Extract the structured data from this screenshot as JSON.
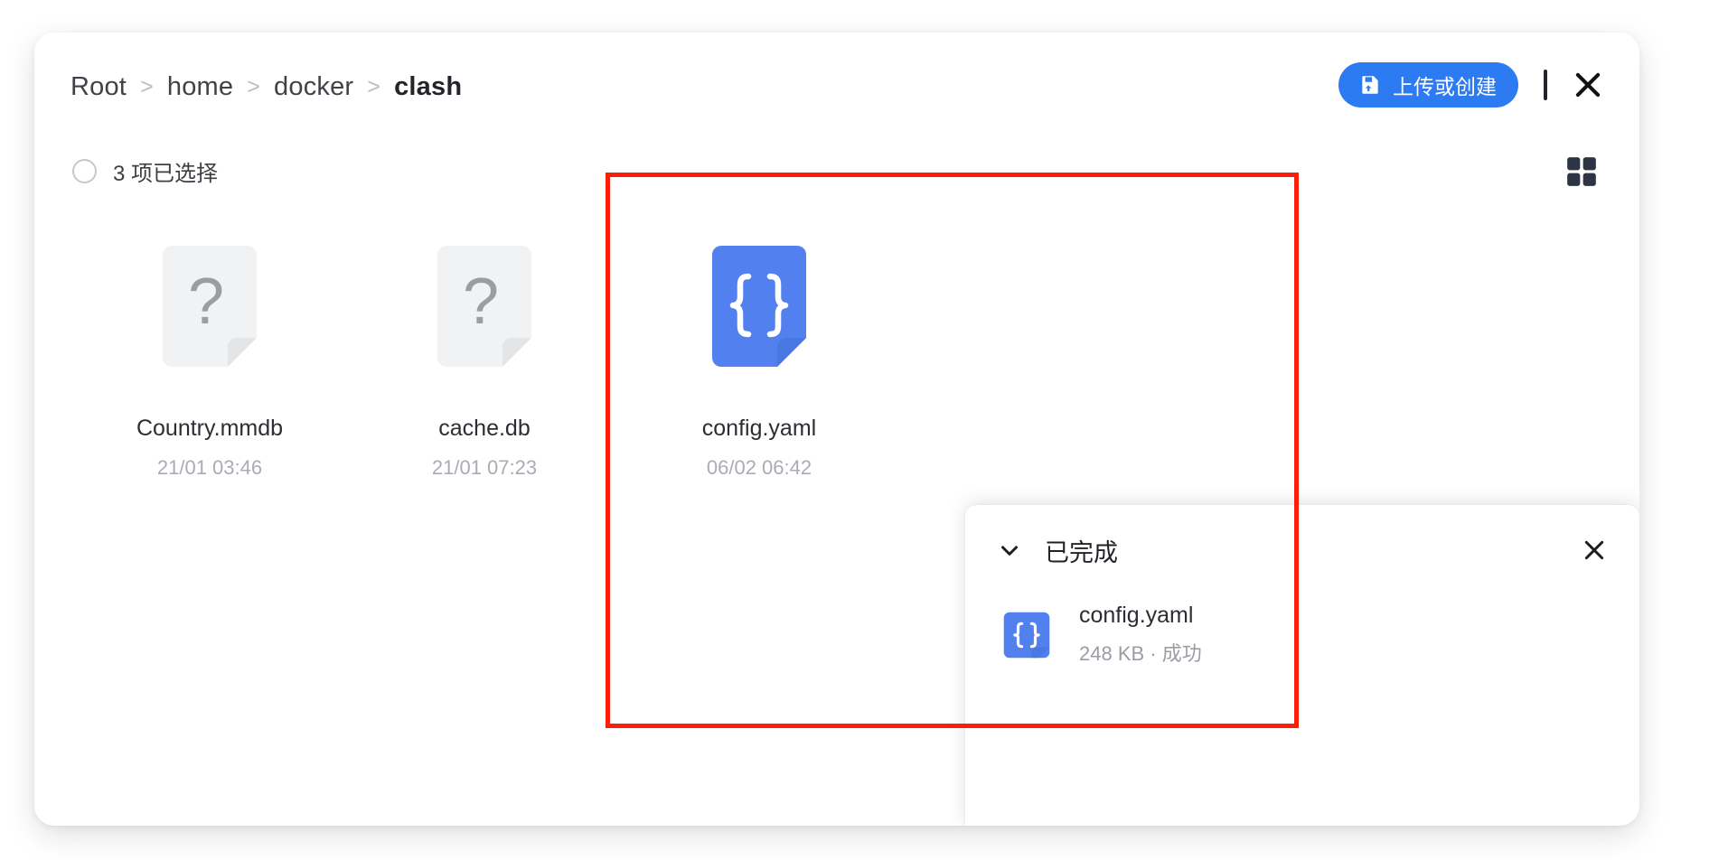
{
  "header": {
    "breadcrumb": [
      {
        "label": "Root",
        "current": false
      },
      {
        "label": "home",
        "current": false
      },
      {
        "label": "docker",
        "current": false
      },
      {
        "label": "clash",
        "current": true
      }
    ],
    "separator": ">",
    "upload_button_label": "上传或创建",
    "upload_button_icon": "save-upload-icon",
    "close_icon": "close-icon",
    "accent_color": "#2c7bf2"
  },
  "toolbar": {
    "selection_label": "3 项已选择",
    "selection_icon": "circle-unchecked-icon",
    "view_toggle_icon": "grid-view-icon"
  },
  "files": [
    {
      "name": "Country.mmdb",
      "date": "21/01 03:46",
      "icon": "unknown-file-icon",
      "icon_color": "#f1f2f3"
    },
    {
      "name": "cache.db",
      "date": "21/01 07:23",
      "icon": "unknown-file-icon",
      "icon_color": "#f1f2f3"
    },
    {
      "name": "config.yaml",
      "date": "06/02 06:42",
      "icon": "json-braces-file-icon",
      "icon_color": "#5281ef"
    }
  ],
  "upload_panel": {
    "title": "已完成",
    "collapse_icon": "chevron-down-icon",
    "close_icon": "close-icon",
    "items": [
      {
        "name": "config.yaml",
        "meta": "248 KB · 成功",
        "size": "248 KB",
        "status": "成功",
        "icon": "json-braces-file-icon",
        "icon_color": "#5281ef"
      }
    ]
  },
  "annotation": {
    "color": "#fb1e09",
    "shape": "rectangle"
  }
}
